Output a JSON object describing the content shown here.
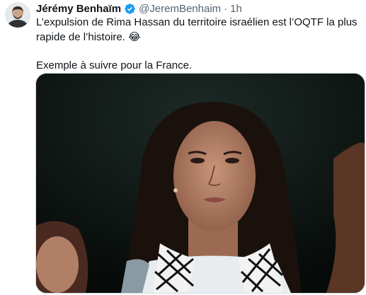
{
  "author": {
    "display_name": "Jérémy Benhaïm",
    "handle": "@JeremBenhaim",
    "separator": "·",
    "time": "1h"
  },
  "tweet": {
    "line1": "L’expulsion de Rima Hassan du territoire israélien est l’OQTF la plus rapide de l’histoire.",
    "emoji": "😂",
    "line2": "Exemple à suivre pour la France."
  },
  "colors": {
    "verified": "#1d9bf0",
    "secondary_text": "#536471",
    "primary_text": "#0f1419"
  },
  "icons": [
    "verified-badge-icon"
  ]
}
